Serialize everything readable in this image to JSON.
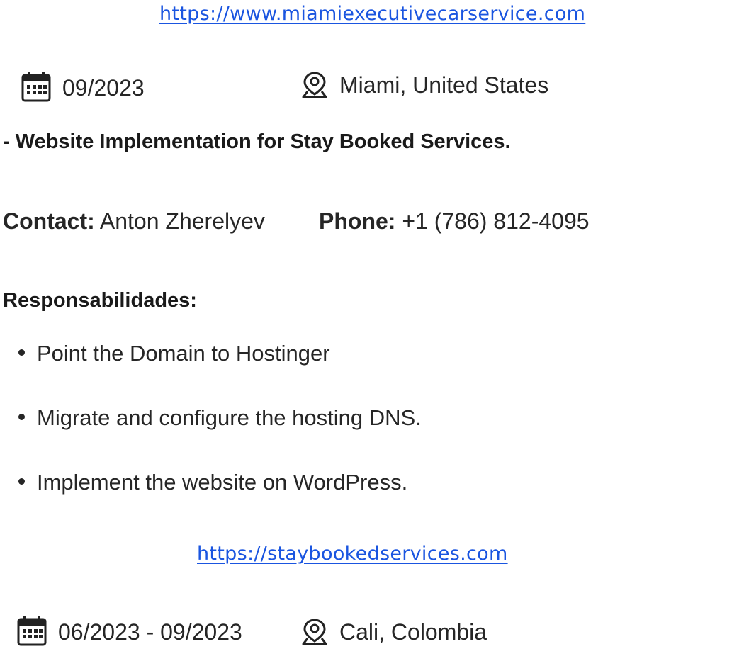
{
  "project1": {
    "url": "https://www.miamiexecutivecarservice.com",
    "date": "09/2023",
    "location": "Miami, United States"
  },
  "project2": {
    "title": "- Website Implementation for Stay Booked Services.",
    "contact_label": "Contact:",
    "contact_value": "Anton Zherelyev",
    "phone_label": "Phone:",
    "phone_value": "+1 (786) 812-4095",
    "responsibilities_heading": "Responsabilidades:",
    "responsibilities": [
      "Point the Domain to Hostinger",
      "Migrate and configure the hosting DNS.",
      "Implement the website on WordPress."
    ],
    "url": "https://staybookedservices.com",
    "date": "06/2023 - 09/2023",
    "location": "Cali, Colombia"
  },
  "icons": {
    "date": "calendar-icon",
    "location": "location-pin-icon"
  }
}
